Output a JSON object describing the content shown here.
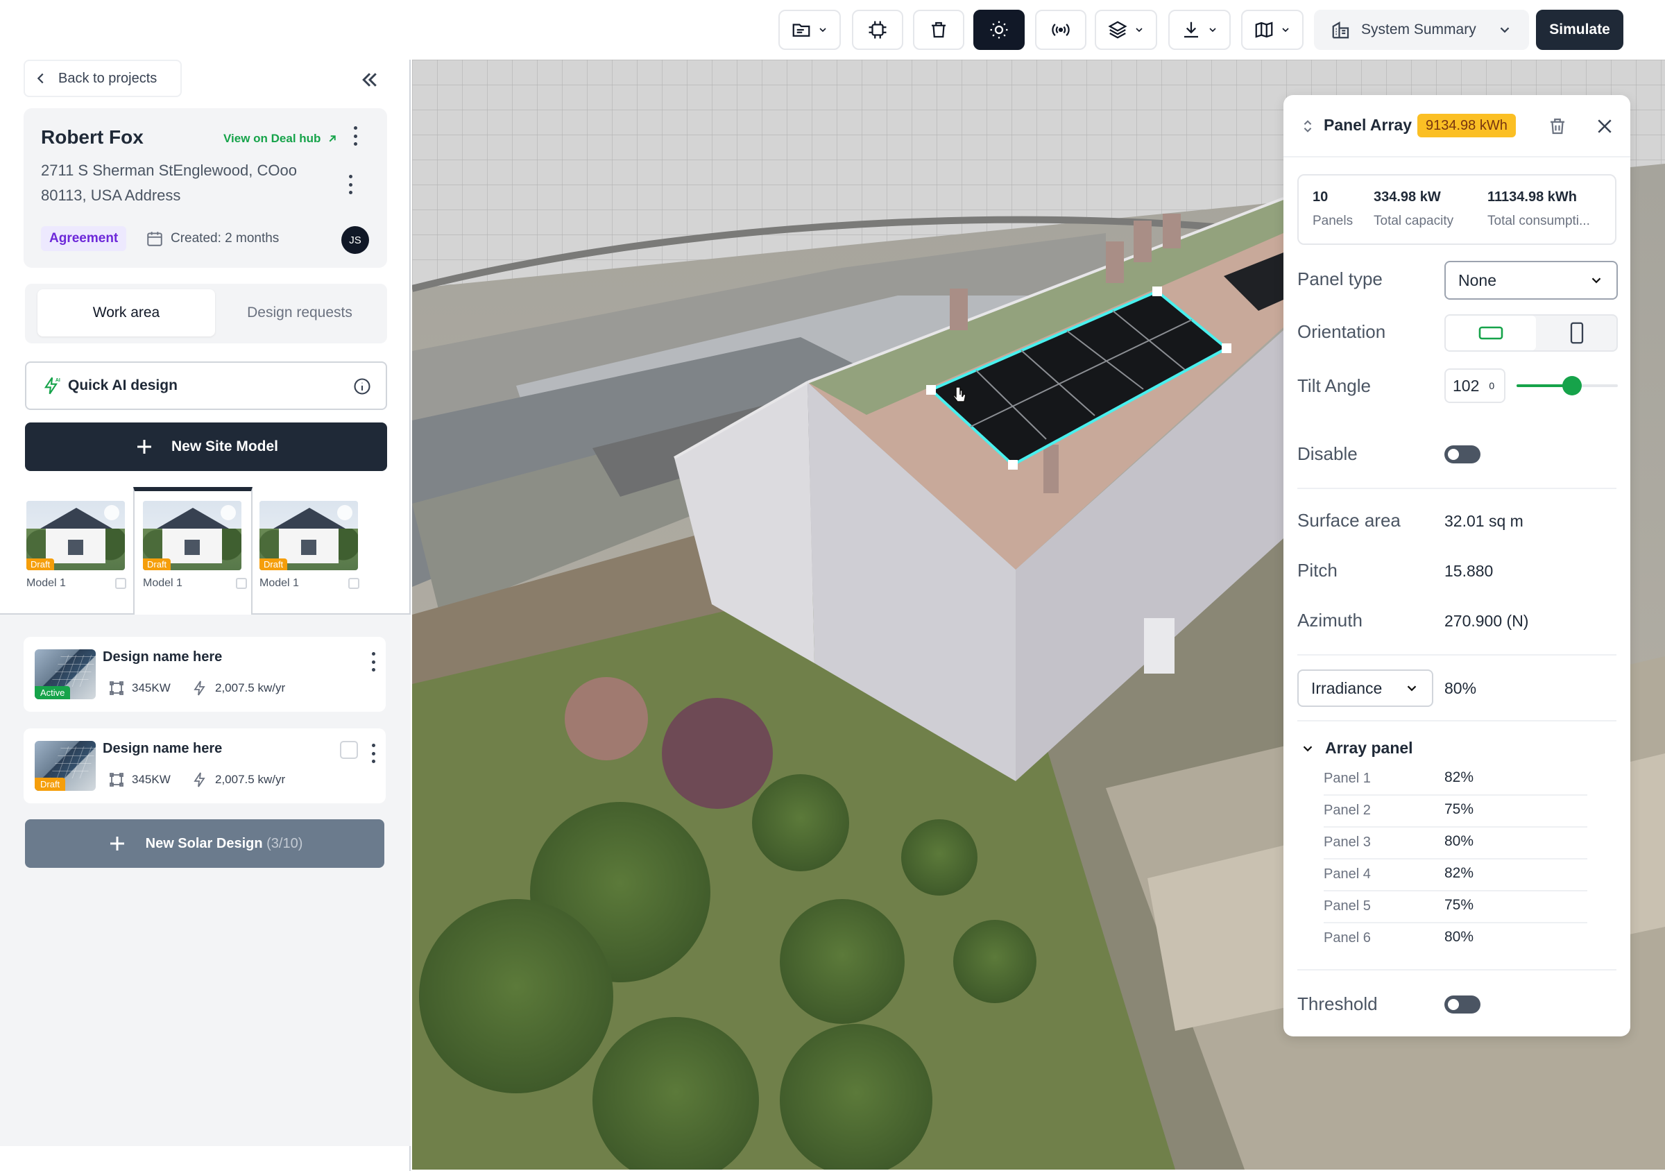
{
  "toolbar": {
    "summary_label": "System Summary",
    "simulate_label": "Simulate"
  },
  "sidebar": {
    "back_label": "Back to projects",
    "customer": {
      "name": "Robert Fox",
      "deal_link": "View on Deal hub",
      "address": "2711 S Sherman StEnglewood, COoo 80113, USA Address",
      "status": "Agreement",
      "created": "Created: 2 months",
      "avatar_initials": "JS"
    },
    "tabs": [
      "Work area",
      "Design requests"
    ],
    "quick_ai_label": "Quick AI design",
    "new_site_label": "New Site Model",
    "models": [
      {
        "label": "Model 1",
        "badge": "Draft"
      },
      {
        "label": "Model 1",
        "badge": "Draft"
      },
      {
        "label": "Model 1",
        "badge": "Draft"
      }
    ],
    "designs": [
      {
        "name": "Design name here",
        "badge": "Active",
        "capacity": "345KW",
        "yield": "2,007.5 kw/yr"
      },
      {
        "name": "Design name here",
        "badge": "Draft",
        "capacity": "345KW",
        "yield": "2,007.5 kw/yr"
      }
    ],
    "new_solar": {
      "label": "New Solar Design",
      "count": "(3/10)"
    }
  },
  "panel": {
    "title": "Panel Array",
    "energy_badge": "9134.98 kWh",
    "stats": [
      {
        "value": "10",
        "label": "Panels"
      },
      {
        "value": "334.98 kW",
        "label": "Total capacity"
      },
      {
        "value": "11134.98 kWh",
        "label": "Total consumpti..."
      }
    ],
    "panel_type": {
      "label": "Panel type",
      "value": "None"
    },
    "orientation_label": "Orientation",
    "tilt": {
      "label": "Tilt Angle",
      "value": "102",
      "unit": "0",
      "slider_fraction": 0.55
    },
    "disable_label": "Disable",
    "surface_area": {
      "label": "Surface area",
      "value": "32.01 sq m"
    },
    "pitch": {
      "label": "Pitch",
      "value": "15.880"
    },
    "azimuth": {
      "label": "Azimuth",
      "value": "270.900 (N)"
    },
    "irradiance": {
      "label": "Irradiance",
      "value": "80%"
    },
    "array_panel_title": "Array panel",
    "array_panels": [
      {
        "name": "Panel 1",
        "value": "82%"
      },
      {
        "name": "Panel 2",
        "value": "75%"
      },
      {
        "name": "Panel 3",
        "value": "80%"
      },
      {
        "name": "Panel 4",
        "value": "82%"
      },
      {
        "name": "Panel 5",
        "value": "75%"
      },
      {
        "name": "Panel 6",
        "value": "80%"
      }
    ],
    "threshold_label": "Threshold"
  },
  "colors": {
    "accent_green": "#16a34a",
    "badge_amber": "#fbbf24",
    "agreement_purple": "#6d28d9",
    "dark": "#1f2937"
  }
}
